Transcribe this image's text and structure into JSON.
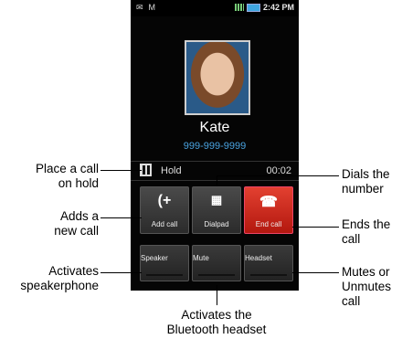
{
  "status_bar": {
    "time": "2:42 PM"
  },
  "caller": {
    "name": "Kate",
    "number": "999-999-9999"
  },
  "hold_row": {
    "label": "Hold",
    "timer": "00:02"
  },
  "buttons": {
    "add_call": "Add call",
    "dialpad": "Dialpad",
    "end_call": "End call",
    "speaker": "Speaker",
    "mute": "Mute",
    "headset": "Headset"
  },
  "callouts": {
    "hold": [
      "Place a call",
      "on hold"
    ],
    "add": [
      "Adds a",
      "new call"
    ],
    "speaker": [
      "Activates",
      "speakerphone"
    ],
    "bluetooth": [
      "Activates the",
      "Bluetooth headset"
    ],
    "dials": [
      "Dials the",
      "number"
    ],
    "ends": [
      "Ends the",
      "call"
    ],
    "mutes": [
      "Mutes or",
      "Unmutes",
      "call"
    ]
  }
}
